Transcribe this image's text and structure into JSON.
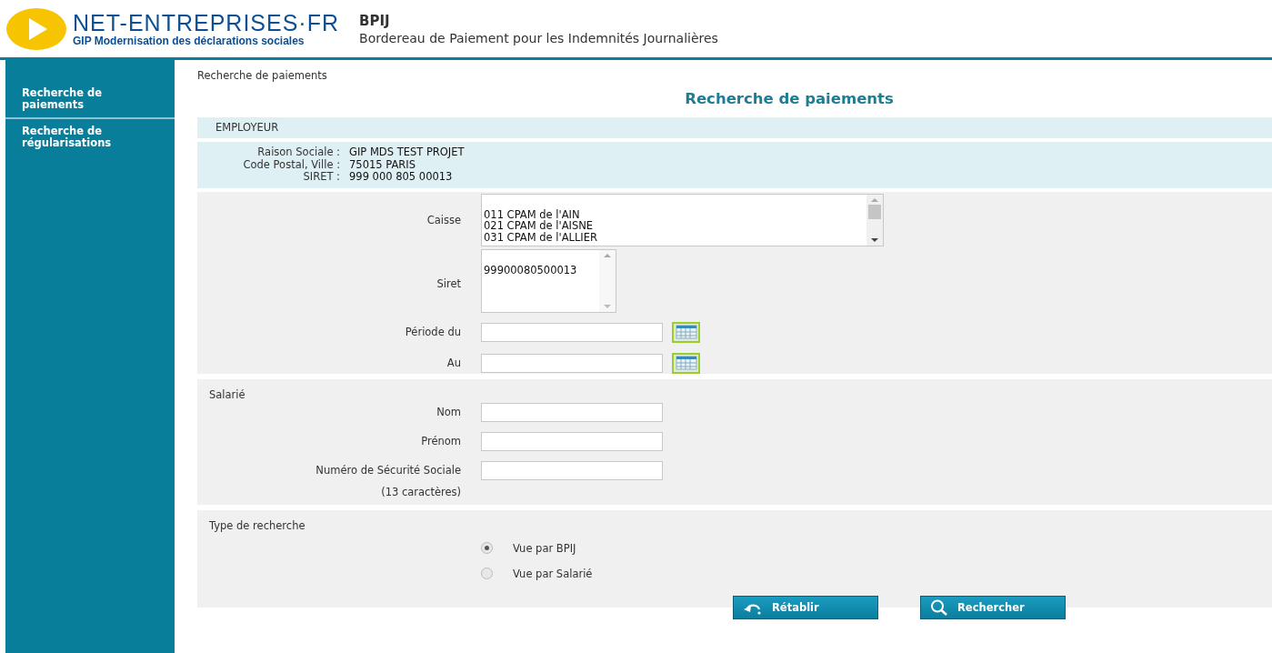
{
  "header": {
    "logo_title": "NET-ENTREPRISES·FR",
    "logo_subtitle": "GIP Modernisation des déclarations sociales",
    "app_title": "BPIJ",
    "app_subtitle": "Bordereau de Paiement pour les Indemnités Journalières"
  },
  "sidebar": {
    "items": [
      {
        "label": "Recherche de paiements"
      },
      {
        "label": "Recherche de régularisations"
      }
    ]
  },
  "breadcrumb": "Recherche de paiements",
  "page_title": "Recherche de paiements",
  "employer": {
    "heading": "EMPLOYEUR",
    "rows": [
      {
        "label": "Raison Sociale :",
        "value": "GIP MDS TEST PROJET"
      },
      {
        "label": "Code Postal, Ville :",
        "value": "75015 PARIS"
      },
      {
        "label": "SIRET :",
        "value": "999 000 805 00013"
      }
    ]
  },
  "criteria": {
    "caisse": {
      "label": "Caisse",
      "options": [
        "011 CPAM de l'AIN",
        "021 CPAM de l'AISNE",
        "031 CPAM de l'ALLIER"
      ]
    },
    "siret": {
      "label": "Siret",
      "options": [
        "99900080500013"
      ]
    },
    "dates": [
      {
        "label": "Période du"
      },
      {
        "label": "Au"
      }
    ]
  },
  "salarie": {
    "heading": "Salarié",
    "fields": [
      {
        "label": "Nom"
      },
      {
        "label": "Prénom"
      },
      {
        "label": "Numéro de Sécurité Sociale",
        "hint": "(13 caractères)"
      }
    ]
  },
  "search_type": {
    "heading": "Type de recherche",
    "options": [
      {
        "label": "Vue par BPIJ",
        "selected": true
      },
      {
        "label": "Vue par Salarié",
        "selected": false
      }
    ]
  },
  "buttons": [
    {
      "kind": "reset",
      "label": "Rétablir"
    },
    {
      "kind": "search",
      "label": "Rechercher"
    }
  ]
}
